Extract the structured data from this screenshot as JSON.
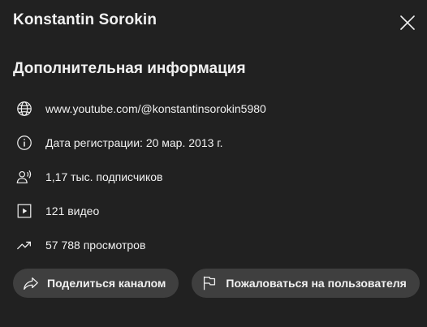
{
  "dialog": {
    "title": "Konstantin Sorokin",
    "close_icon": "close-icon"
  },
  "section": {
    "title": "Дополнительная информация"
  },
  "rows": [
    {
      "icon": "globe-icon",
      "text": "www.youtube.com/@konstantinsorokin5980"
    },
    {
      "icon": "info-icon",
      "text": "Дата регистрации: 20 мар. 2013 г."
    },
    {
      "icon": "subscribers-icon",
      "text": "1,17 тыс. подписчиков"
    },
    {
      "icon": "video-icon",
      "text": "121 видео"
    },
    {
      "icon": "trending-icon",
      "text": "57 788 просмотров"
    }
  ],
  "buttons": {
    "share_label": "Поделиться каналом",
    "share_icon": "share-icon",
    "report_label": "Пожаловаться на пользователя",
    "report_icon": "flag-icon"
  },
  "colors": {
    "background": "#212121",
    "text": "#f1f1f1",
    "button": "#3f3f3f"
  }
}
